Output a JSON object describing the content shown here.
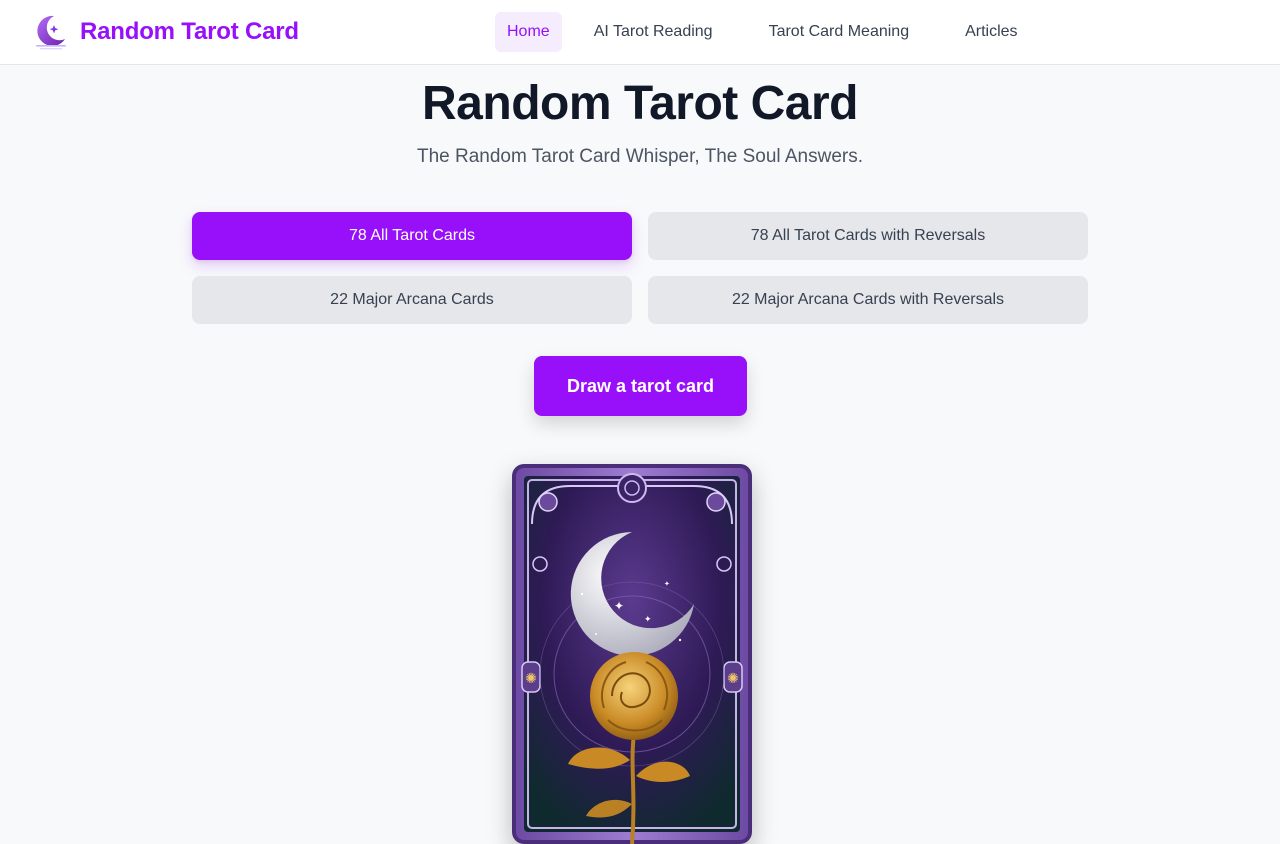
{
  "header": {
    "brand_name": "Random Tarot Card",
    "nav": [
      {
        "label": "Home",
        "active": true
      },
      {
        "label": "AI Tarot Reading",
        "active": false
      },
      {
        "label": "Tarot Card Meaning",
        "active": false
      },
      {
        "label": "Articles",
        "active": false
      }
    ]
  },
  "hero": {
    "title": "Random Tarot Card",
    "subtitle": "The Random Tarot Card Whisper, The Soul Answers."
  },
  "deck_options": [
    {
      "label": "78 All Tarot Cards",
      "selected": true
    },
    {
      "label": "78 All Tarot Cards with Reversals",
      "selected": false
    },
    {
      "label": "22 Major Arcana Cards",
      "selected": false
    },
    {
      "label": "22 Major Arcana Cards with Reversals",
      "selected": false
    }
  ],
  "draw_button": {
    "label": "Draw a tarot card"
  },
  "card_back": {
    "motif": "crescent-moon-and-golden-rose"
  },
  "colors": {
    "accent": "#9810fa",
    "accent_soft": "#f5ecfe",
    "option_bg": "#e5e7eb",
    "page_bg": "#f8f9fb",
    "title": "#111827",
    "card_purple": "#3b1f66",
    "rose_gold": "#d9a13a"
  }
}
